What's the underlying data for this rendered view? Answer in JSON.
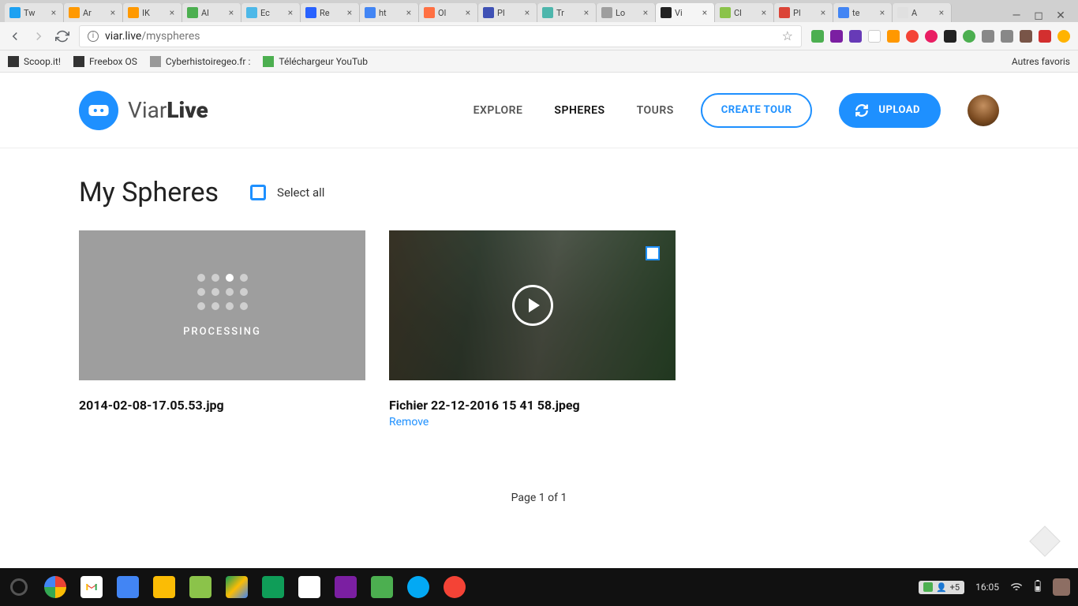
{
  "browser": {
    "tabs": [
      {
        "title": "Tw",
        "favicon": "#1da1f2"
      },
      {
        "title": "Ar",
        "favicon": "#ff9900"
      },
      {
        "title": "IK",
        "favicon": "#ff9900"
      },
      {
        "title": "Al",
        "favicon": "#4caf50"
      },
      {
        "title": "Ec",
        "favicon": "#4db8e8"
      },
      {
        "title": "Re",
        "favicon": "#2962ff"
      },
      {
        "title": "ht",
        "favicon": "#4285f4"
      },
      {
        "title": "Ol",
        "favicon": "#ff7043"
      },
      {
        "title": "Pl",
        "favicon": "#3f51b5"
      },
      {
        "title": "Tr",
        "favicon": "#4db6ac"
      },
      {
        "title": "Lo",
        "favicon": "#9e9e9e"
      },
      {
        "title": "Vi",
        "favicon": "#222",
        "active": true
      },
      {
        "title": "Cl",
        "favicon": "#8bc34a"
      },
      {
        "title": "Pl",
        "favicon": "#db4437"
      },
      {
        "title": "te",
        "favicon": "#4285f4"
      },
      {
        "title": "A",
        "favicon": "#e0e0e0"
      }
    ],
    "url_host": "viar.live",
    "url_path": "/myspheres",
    "bookmarks": [
      {
        "label": "Scoop.it!"
      },
      {
        "label": "Freebox OS"
      },
      {
        "label": "Cyberhistoiregeo.fr : "
      },
      {
        "label": "Téléchargeur YouTub"
      }
    ],
    "other_bookmarks": "Autres favoris"
  },
  "site": {
    "logo_text_1": "Viar",
    "logo_text_2": "Live",
    "nav": {
      "explore": "EXPLORE",
      "spheres": "SPHERES",
      "tours": "TOURS"
    },
    "create_tour": "CREATE TOUR",
    "upload": "UPLOAD"
  },
  "page": {
    "title": "My Spheres",
    "select_all": "Select all",
    "cards": [
      {
        "processing": true,
        "processing_label": "PROCESSING",
        "title": "2014-02-08-17.05.53.jpg"
      },
      {
        "processing": false,
        "title": "Fichier 22-12-2016 15 41 58.jpeg",
        "remove": "Remove"
      }
    ],
    "pagination": "Page 1 of 1"
  },
  "taskbar": {
    "badge": "+5",
    "clock": "16:05"
  }
}
